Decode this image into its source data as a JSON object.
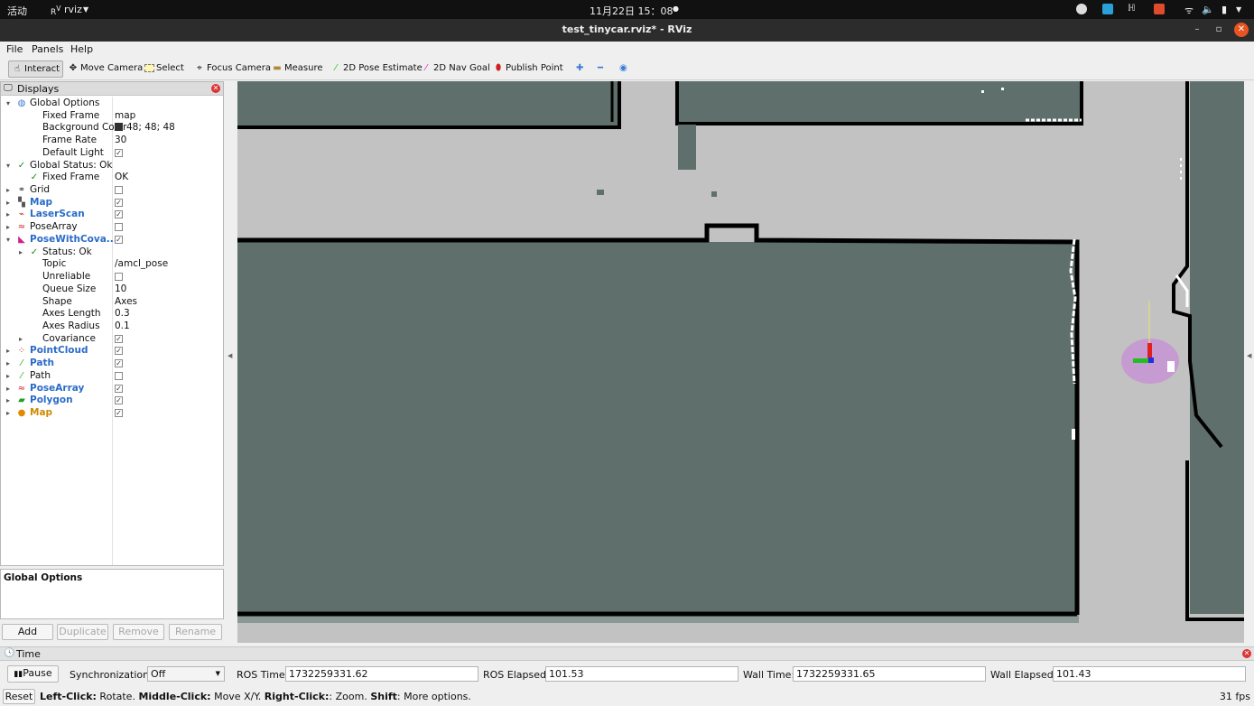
{
  "os_bar": {
    "activities": "活动",
    "app_name": "rviz",
    "clock": "11月22日  15：08"
  },
  "window": {
    "title": "test_tinycar.rviz* - RViz"
  },
  "menu": [
    {
      "label": "File"
    },
    {
      "label": "Panels"
    },
    {
      "label": "Help"
    }
  ],
  "toolbar": {
    "interact": "Interact",
    "move_camera": "Move Camera",
    "select": "Select",
    "focus_camera": "Focus Camera",
    "measure": "Measure",
    "pose_estimate": "2D Pose Estimate",
    "nav_goal": "2D Nav Goal",
    "publish_point": "Publish Point"
  },
  "displays": {
    "title": "Displays",
    "rows": [
      {
        "name": "Global Options",
        "value": "",
        "arrow": "open",
        "icon": "globe-icon"
      },
      {
        "name": "Fixed Frame",
        "value": "map"
      },
      {
        "name": "Background Color",
        "value": "48; 48; 48",
        "swatch": "#303030"
      },
      {
        "name": "Frame Rate",
        "value": "30"
      },
      {
        "name": "Default Light",
        "checked": true
      },
      {
        "name": "Global Status: Ok",
        "arrow": "open",
        "icon": "check-icon"
      },
      {
        "name": "Fixed Frame",
        "value": "OK",
        "icon": "check-icon"
      },
      {
        "name": "Grid",
        "arrow": "closed",
        "icon": "grid-icon",
        "checked": false
      },
      {
        "name": "Map",
        "arrow": "closed",
        "icon": "map-icon",
        "checked": true,
        "style": "blue"
      },
      {
        "name": "LaserScan",
        "arrow": "closed",
        "icon": "laserscan-icon",
        "checked": true,
        "style": "blue"
      },
      {
        "name": "PoseArray",
        "arrow": "closed",
        "icon": "posearray-icon",
        "checked": false
      },
      {
        "name": "PoseWithCova...",
        "arrow": "open",
        "icon": "pose-icon",
        "checked": true,
        "style": "blue"
      },
      {
        "name": "Status: Ok",
        "arrow": "closed",
        "icon": "check-icon"
      },
      {
        "name": "Topic",
        "value": "/amcl_pose"
      },
      {
        "name": "Unreliable",
        "checked": false
      },
      {
        "name": "Queue Size",
        "value": "10"
      },
      {
        "name": "Shape",
        "value": "Axes"
      },
      {
        "name": "Axes Length",
        "value": "0.3"
      },
      {
        "name": "Axes Radius",
        "value": "0.1"
      },
      {
        "name": "Covariance",
        "arrow": "closed",
        "checked": true
      },
      {
        "name": "PointCloud",
        "arrow": "closed",
        "icon": "pointcloud-icon",
        "checked": true,
        "style": "blue"
      },
      {
        "name": "Path",
        "arrow": "closed",
        "icon": "path-icon",
        "checked": true,
        "style": "blue"
      },
      {
        "name": "Path",
        "arrow": "closed",
        "icon": "path-icon",
        "checked": false
      },
      {
        "name": "PoseArray",
        "arrow": "closed",
        "icon": "posearray-icon",
        "checked": true,
        "style": "blue"
      },
      {
        "name": "Polygon",
        "arrow": "closed",
        "icon": "polygon-icon",
        "checked": true,
        "style": "blue"
      },
      {
        "name": "Map",
        "arrow": "closed",
        "icon": "warning-icon",
        "checked": true,
        "style": "orange"
      }
    ]
  },
  "description": {
    "title": "Global Options"
  },
  "panel_buttons": {
    "add": "Add",
    "duplicate": "Duplicate",
    "remove": "Remove",
    "rename": "Rename"
  },
  "time": {
    "title": "Time",
    "pause": "Pause",
    "sync_label": "Synchronization:",
    "sync_value": "Off",
    "ros_time_label": "ROS Time:",
    "ros_time": "1732259331.62",
    "ros_elapsed_label": "ROS Elapsed:",
    "ros_elapsed": "101.53",
    "wall_time_label": "Wall Time:",
    "wall_time": "1732259331.65",
    "wall_elapsed_label": "Wall Elapsed:",
    "wall_elapsed": "101.43"
  },
  "status": {
    "reset": "Reset",
    "left_click": "Left-Click:",
    "left_click_text": " Rotate. ",
    "middle_click": "Middle-Click:",
    "middle_click_text": " Move X/Y. ",
    "right_click": "Right-Click:",
    "right_click_text": ": Zoom. ",
    "shift": "Shift",
    "shift_text": ": More options.",
    "fps": "31 fps"
  },
  "colors": {
    "map_free": "#c2c2c2",
    "map_unknown": "#5f706c",
    "map_occupied": "#000000",
    "laser": "#ffffff",
    "covariance": "#c69bd2"
  }
}
